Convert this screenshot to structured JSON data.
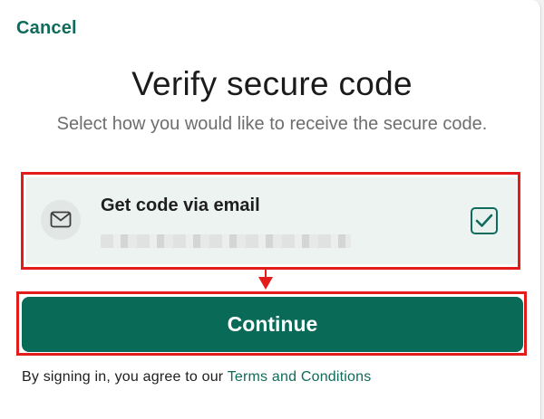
{
  "header": {
    "cancel_label": "Cancel"
  },
  "main": {
    "title": "Verify secure code",
    "subtitle": "Select how you would like to receive the secure code."
  },
  "option": {
    "label": "Get code via email",
    "icon": "mail-icon",
    "checked": true,
    "check_icon": "checkmark-icon"
  },
  "actions": {
    "continue_label": "Continue"
  },
  "footer": {
    "terms_prefix": "By signing in, you agree to our ",
    "terms_link": "Terms and Conditions"
  },
  "colors": {
    "accent": "#0a6a58",
    "highlight": "#e41b1b",
    "option_background": "#ecf3f1"
  }
}
